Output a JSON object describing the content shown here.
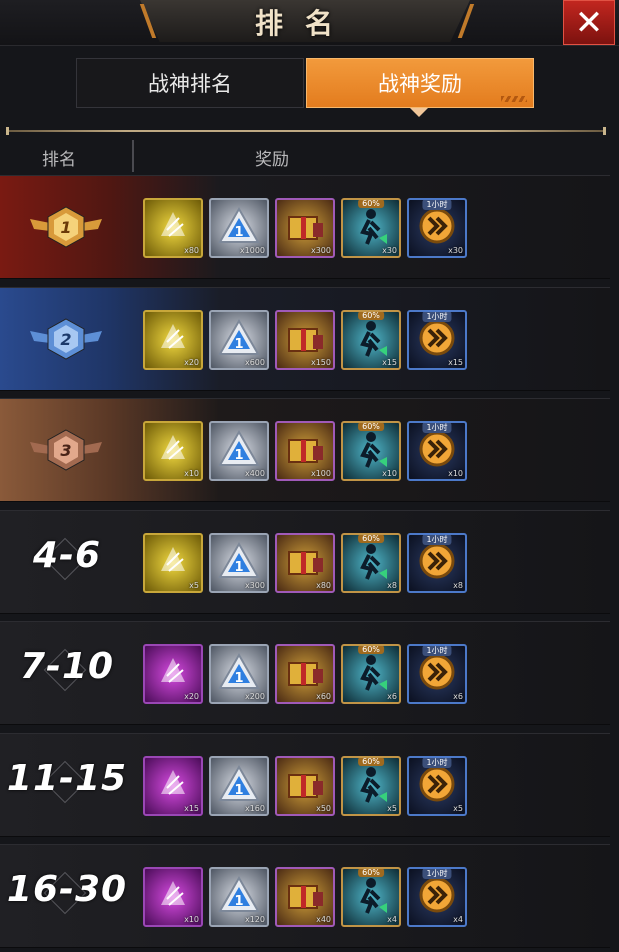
{
  "header": {
    "title": "排名"
  },
  "tabs": [
    {
      "label": "战神排名",
      "active": false
    },
    {
      "label": "战神奖励",
      "active": true
    }
  ],
  "columns": {
    "rank": "排名",
    "reward": "奖励"
  },
  "colors": {
    "accent": "#e8832a",
    "close": "#b8231c"
  },
  "rows": [
    {
      "rank": "1",
      "style": "gold-medal",
      "items": [
        {
          "icon": "yellow-crystal-icon",
          "qty": "x80"
        },
        {
          "icon": "blue-triangle-token-icon",
          "qty": "x1000"
        },
        {
          "icon": "gift-crate-icon",
          "qty": "x300"
        },
        {
          "icon": "runner-speed-card-icon",
          "badge": "60%",
          "qty": "x30"
        },
        {
          "icon": "fast-forward-boost-icon",
          "badge": "1小时",
          "qty": "x30"
        }
      ]
    },
    {
      "rank": "2",
      "style": "silver-medal",
      "items": [
        {
          "icon": "yellow-crystal-icon",
          "qty": "x20"
        },
        {
          "icon": "blue-triangle-token-icon",
          "qty": "x600"
        },
        {
          "icon": "gift-crate-icon",
          "qty": "x150"
        },
        {
          "icon": "runner-speed-card-icon",
          "badge": "60%",
          "qty": "x15"
        },
        {
          "icon": "fast-forward-boost-icon",
          "badge": "1小时",
          "qty": "x15"
        }
      ]
    },
    {
      "rank": "3",
      "style": "bronze-medal",
      "items": [
        {
          "icon": "yellow-crystal-icon",
          "qty": "x10"
        },
        {
          "icon": "blue-triangle-token-icon",
          "qty": "x400"
        },
        {
          "icon": "gift-crate-icon",
          "qty": "x100"
        },
        {
          "icon": "runner-speed-card-icon",
          "badge": "60%",
          "qty": "x10"
        },
        {
          "icon": "fast-forward-boost-icon",
          "badge": "1小时",
          "qty": "x10"
        }
      ]
    },
    {
      "rank": "4-6",
      "style": "text",
      "items": [
        {
          "icon": "yellow-crystal-icon",
          "qty": "x5"
        },
        {
          "icon": "blue-triangle-token-icon",
          "qty": "x300"
        },
        {
          "icon": "gift-crate-icon",
          "qty": "x80"
        },
        {
          "icon": "runner-speed-card-icon",
          "badge": "60%",
          "qty": "x8"
        },
        {
          "icon": "fast-forward-boost-icon",
          "badge": "1小时",
          "qty": "x8"
        }
      ]
    },
    {
      "rank": "7-10",
      "style": "text",
      "items": [
        {
          "icon": "purple-crystal-icon",
          "qty": "x20"
        },
        {
          "icon": "blue-triangle-token-icon",
          "qty": "x200"
        },
        {
          "icon": "gift-crate-icon",
          "qty": "x60"
        },
        {
          "icon": "runner-speed-card-icon",
          "badge": "60%",
          "qty": "x6"
        },
        {
          "icon": "fast-forward-boost-icon",
          "badge": "1小时",
          "qty": "x6"
        }
      ]
    },
    {
      "rank": "11-15",
      "style": "text",
      "items": [
        {
          "icon": "purple-crystal-icon",
          "qty": "x15"
        },
        {
          "icon": "blue-triangle-token-icon",
          "qty": "x160"
        },
        {
          "icon": "gift-crate-icon",
          "qty": "x50"
        },
        {
          "icon": "runner-speed-card-icon",
          "badge": "60%",
          "qty": "x5"
        },
        {
          "icon": "fast-forward-boost-icon",
          "badge": "1小时",
          "qty": "x5"
        }
      ]
    },
    {
      "rank": "16-30",
      "style": "text",
      "items": [
        {
          "icon": "purple-crystal-icon",
          "qty": "x10"
        },
        {
          "icon": "blue-triangle-token-icon",
          "qty": "x120"
        },
        {
          "icon": "gift-crate-icon",
          "qty": "x40"
        },
        {
          "icon": "runner-speed-card-icon",
          "badge": "60%",
          "qty": "x4"
        },
        {
          "icon": "fast-forward-boost-icon",
          "badge": "1小时",
          "qty": "x4"
        }
      ]
    }
  ]
}
